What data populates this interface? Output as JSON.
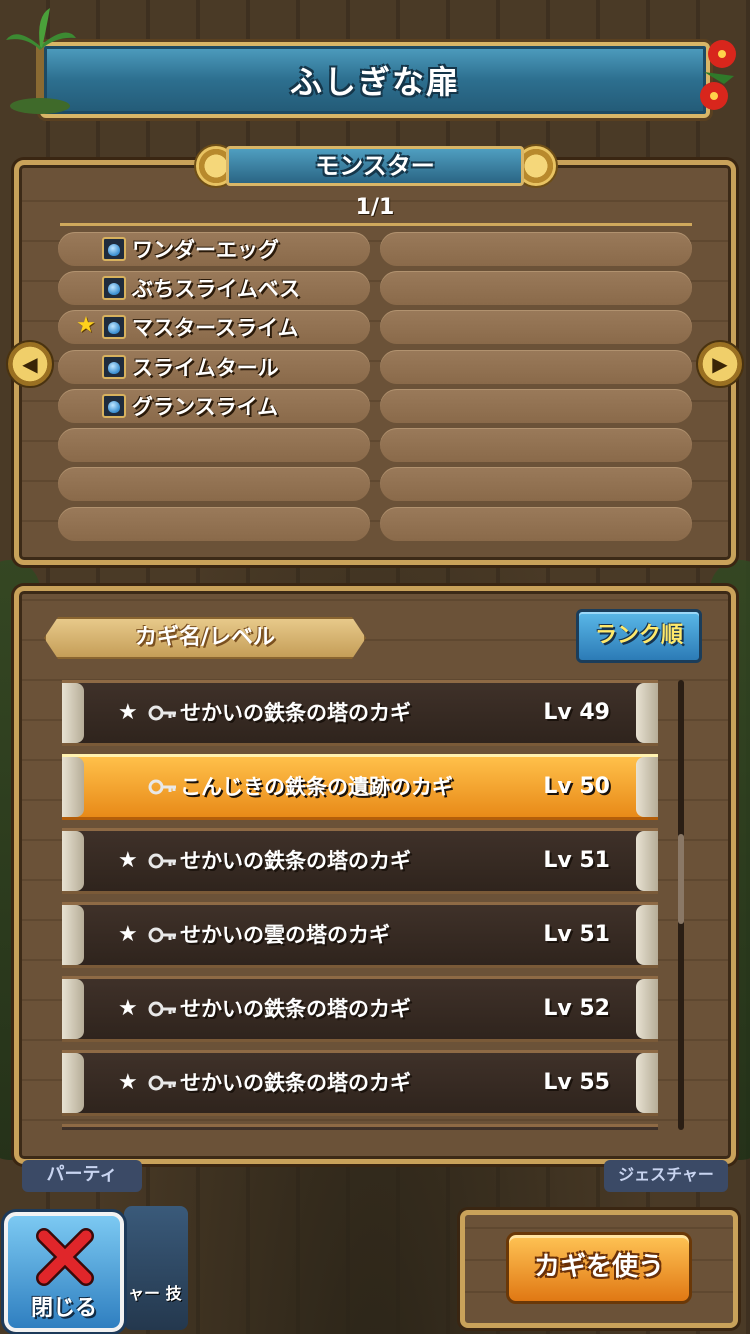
{
  "header": {
    "title": "ふしぎな扉"
  },
  "monster_panel": {
    "banner": "モンスター",
    "page": "1/1",
    "monsters": [
      {
        "name": "ワンダーエッグ",
        "favorite": false
      },
      {
        "name": "ぶちスライムベス",
        "favorite": false
      },
      {
        "name": "マスタースライム",
        "favorite": true
      },
      {
        "name": "スライムタール",
        "favorite": false
      },
      {
        "name": "グランスライム",
        "favorite": false
      }
    ],
    "star_glyph": "★",
    "arrow_left": "◀",
    "arrow_right": "▶"
  },
  "key_panel": {
    "header_label": "カギ名/レベル",
    "sort_button": "ランク順",
    "keys": [
      {
        "star": "★",
        "name": "せかいの鉄条の塔のカギ",
        "level": "Lv 49",
        "selected": false
      },
      {
        "star": "",
        "name": "こんじきの鉄条の遺跡のカギ",
        "level": "Lv 50",
        "selected": true
      },
      {
        "star": "★",
        "name": "せかいの鉄条の塔のカギ",
        "level": "Lv 51",
        "selected": false
      },
      {
        "star": "★",
        "name": "せかいの雲の塔のカギ",
        "level": "Lv 51",
        "selected": false
      },
      {
        "star": "★",
        "name": "せかいの鉄条の塔のカギ",
        "level": "Lv 52",
        "selected": false
      },
      {
        "star": "★",
        "name": "せかいの鉄条の塔のカギ",
        "level": "Lv 55",
        "selected": false
      }
    ]
  },
  "bottom": {
    "party_tab": "パーティ",
    "gesture_tab": "ジェスチャー",
    "close_label": "閉じる",
    "char_tile_label": "ャー\n技",
    "use_key_button": "カギを使う"
  },
  "colors": {
    "title_blue": "#2d6f8f",
    "gold_border": "#c9a25a",
    "selected_orange": "#e88a18",
    "close_blue": "#2f7fc0"
  }
}
